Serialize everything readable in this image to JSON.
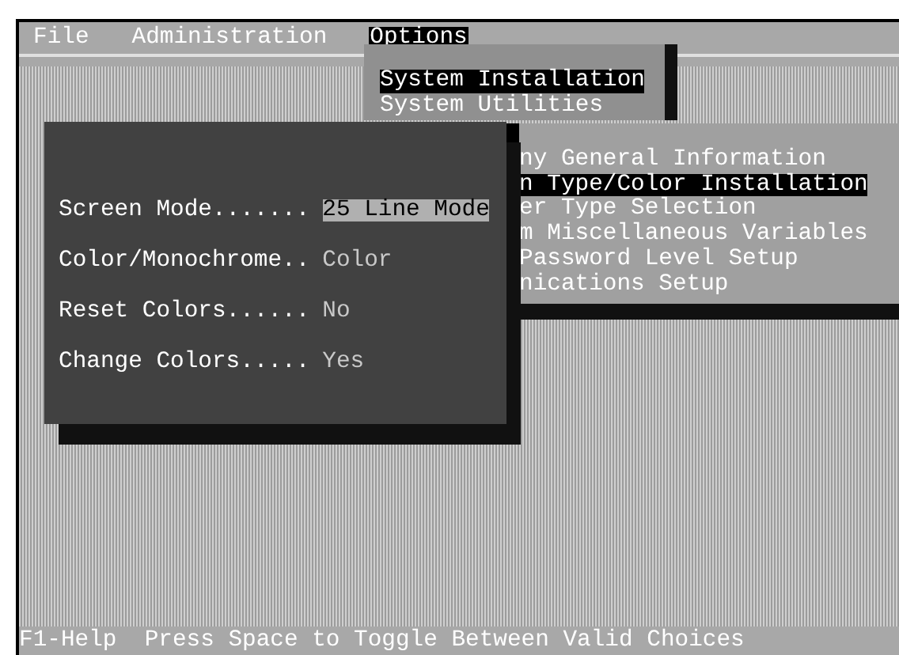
{
  "menu_bar": [
    {
      "label": "File",
      "selected": false
    },
    {
      "label": "Administration",
      "selected": false
    },
    {
      "label": "Options",
      "selected": true
    }
  ],
  "options_menu": [
    {
      "label": "System Installation",
      "selected": true
    },
    {
      "label": "System Utilities",
      "selected": false
    }
  ],
  "submenu": [
    {
      "label": "ny General Information",
      "selected": false
    },
    {
      "label": "n Type/Color Installation",
      "selected": true
    },
    {
      "label": "er Type Selection",
      "selected": false
    },
    {
      "label": "m Miscellaneous Variables",
      "selected": false
    },
    {
      "label": "Password Level Setup",
      "selected": false
    },
    {
      "label": "nications Setup",
      "selected": false
    }
  ],
  "dialog": {
    "fields": [
      {
        "label": "Screen Mode.......",
        "value": "25 Line Mode",
        "selected": true
      },
      {
        "label": "Color/Monochrome..",
        "value": "Color",
        "selected": false
      },
      {
        "label": "Reset Colors......",
        "value": "No",
        "selected": false
      },
      {
        "label": "Change Colors.....",
        "value": "Yes",
        "selected": false
      }
    ]
  },
  "status_bar": "F1-Help  Press Space to Toggle Between Valid Choices"
}
